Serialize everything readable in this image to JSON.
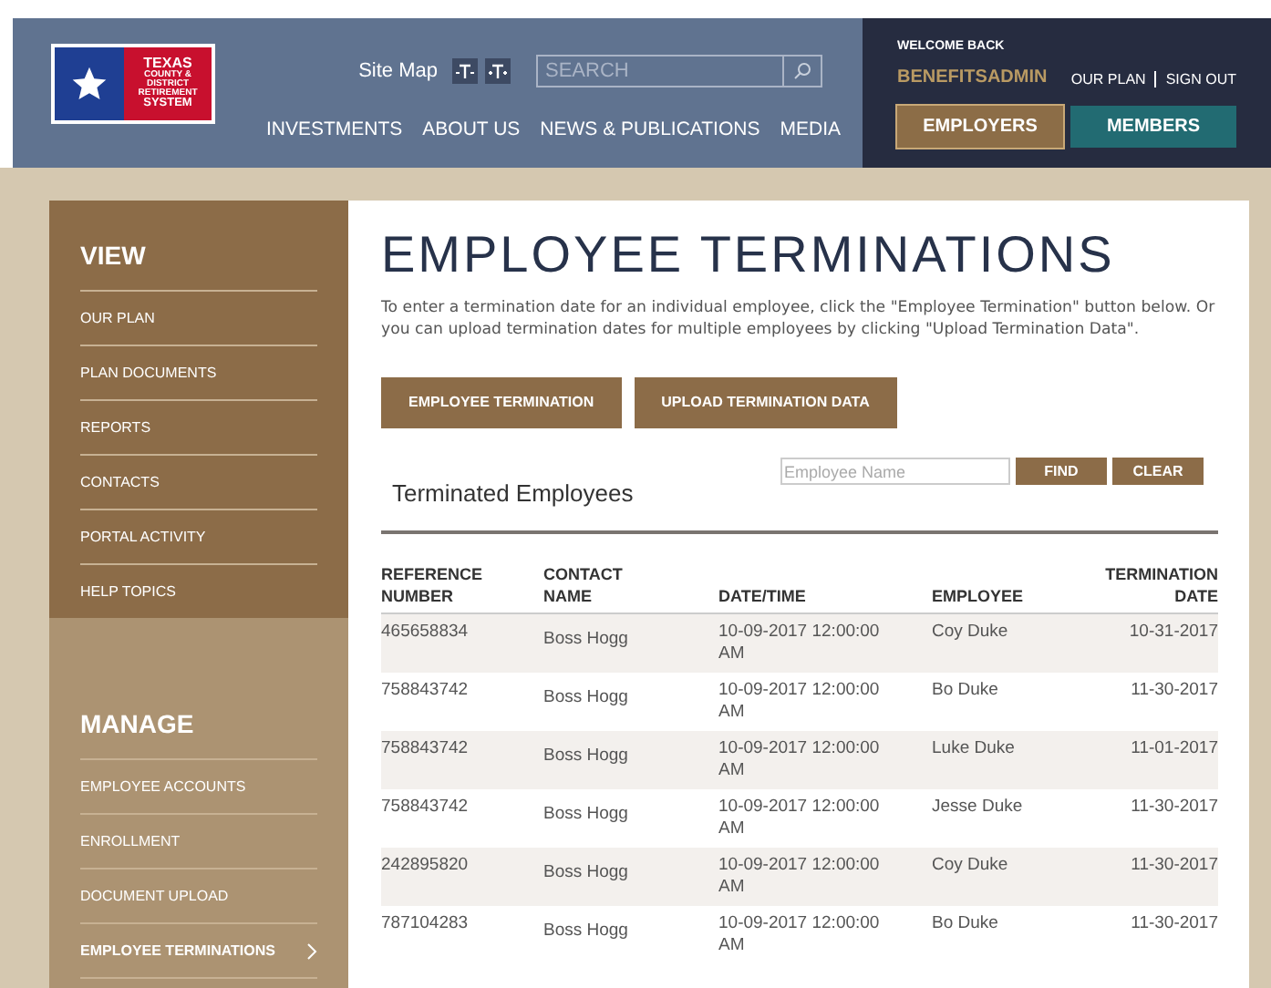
{
  "logo": {
    "lines": [
      "TEXAS",
      "COUNTY &",
      "DISTRICT",
      "RETIREMENT",
      "SYSTEM"
    ]
  },
  "header": {
    "site_map": "Site Map",
    "search": {
      "placeholder": "SEARCH"
    },
    "nav": [
      "INVESTMENTS",
      "ABOUT US",
      "NEWS & PUBLICATIONS",
      "MEDIA"
    ],
    "welcome": "WELCOME BACK",
    "user": "BENEFITSADMIN",
    "links": [
      "OUR PLAN",
      "SIGN OUT"
    ],
    "portals": [
      {
        "label": "EMPLOYERS",
        "selected": true
      },
      {
        "label": "MEMBERS",
        "selected": false
      }
    ]
  },
  "sidebar": {
    "sections": [
      {
        "title": "VIEW",
        "kind": "view",
        "items": [
          {
            "label": "OUR PLAN",
            "selected": false
          },
          {
            "label": "PLAN DOCUMENTS",
            "selected": false
          },
          {
            "label": "REPORTS",
            "selected": false
          },
          {
            "label": "CONTACTS",
            "selected": false
          },
          {
            "label": "PORTAL ACTIVITY",
            "selected": false
          },
          {
            "label": "HELP TOPICS",
            "selected": false
          }
        ]
      },
      {
        "title": "MANAGE",
        "kind": "manage",
        "items": [
          {
            "label": "EMPLOYEE ACCOUNTS",
            "selected": false
          },
          {
            "label": "ENROLLMENT",
            "selected": false
          },
          {
            "label": "DOCUMENT UPLOAD",
            "selected": false
          },
          {
            "label": "EMPLOYEE TERMINATIONS",
            "selected": true
          }
        ]
      }
    ]
  },
  "page": {
    "title": "EMPLOYEE TERMINATIONS",
    "intro": "To enter a termination date for an individual employee, click the \"Employee Termination\" button below. Or you can upload termination dates for multiple employees by clicking \"Upload Termination Data\".",
    "actions": [
      "EMPLOYEE TERMINATION",
      "UPLOAD TERMINATION DATA"
    ],
    "list_title": "Terminated Employees",
    "filter": {
      "placeholder": "Employee Name",
      "buttons": [
        "FIND",
        "CLEAR"
      ]
    }
  },
  "table": {
    "columns": [
      "REFERENCE NUMBER",
      "CONTACT NAME",
      "DATE/TIME",
      "EMPLOYEE",
      "TERMINATION DATE"
    ],
    "rows": [
      [
        "465658834",
        "Boss Hogg",
        "10-09-2017 12:00:00 AM",
        "Coy Duke",
        "10-31-2017"
      ],
      [
        "758843742",
        "Boss Hogg",
        "10-09-2017 12:00:00 AM",
        "Bo Duke",
        "11-30-2017"
      ],
      [
        "758843742",
        "Boss Hogg",
        "10-09-2017 12:00:00 AM",
        "Luke Duke",
        "11-01-2017"
      ],
      [
        "758843742",
        "Boss Hogg",
        "10-09-2017 12:00:00 AM",
        "Jesse Duke",
        "11-30-2017"
      ],
      [
        "242895820",
        "Boss Hogg",
        "10-09-2017 12:00:00 AM",
        "Coy Duke",
        "11-30-2017"
      ],
      [
        "787104283",
        "Boss Hogg",
        "10-09-2017 12:00:00 AM",
        "Bo Duke",
        "11-30-2017"
      ]
    ]
  }
}
